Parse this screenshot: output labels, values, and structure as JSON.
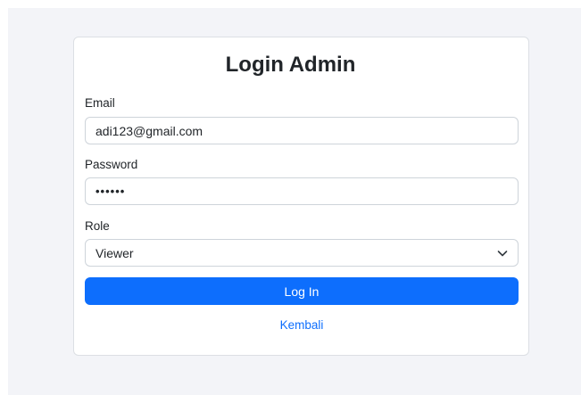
{
  "form": {
    "title": "Login Admin",
    "email": {
      "label": "Email",
      "value": "adi123@gmail.com"
    },
    "password": {
      "label": "Password",
      "value": "••••••"
    },
    "role": {
      "label": "Role",
      "selected": "Viewer"
    },
    "submit_label": "Log In",
    "back_link": "Kembali"
  },
  "colors": {
    "primary": "#0d6efd",
    "page_background": "#f3f4f8"
  },
  "icons": {
    "role_dropdown": "chevron-down-icon"
  }
}
